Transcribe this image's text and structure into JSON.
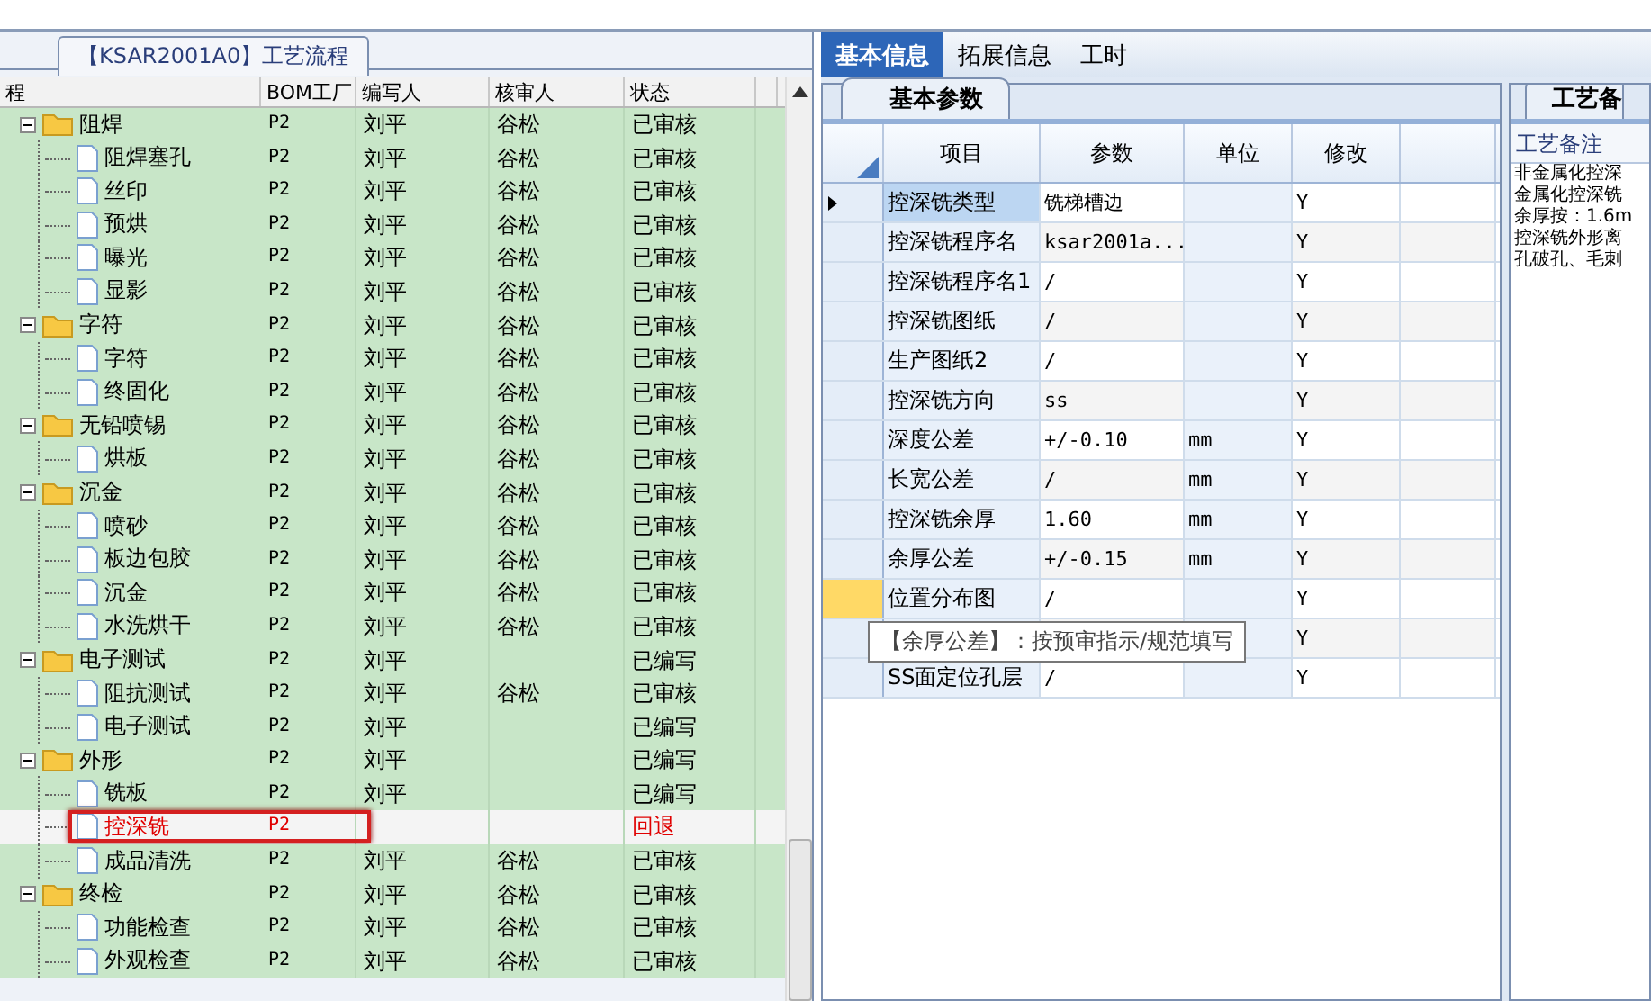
{
  "left_panel": {
    "tab": "【KSAR2001A0】工艺流程",
    "columns": [
      "程",
      "BOM工厂",
      "编写人",
      "核审人",
      "状态"
    ],
    "tree": [
      {
        "name": "阻焊",
        "bom": "P2",
        "writer": "刘平",
        "reviewer": "谷松",
        "status": "已审核",
        "expanded": true,
        "selected": false,
        "children": [
          {
            "name": "阻焊塞孔",
            "bom": "P2",
            "writer": "刘平",
            "reviewer": "谷松",
            "status": "已审核",
            "selected": false
          },
          {
            "name": "丝印",
            "bom": "P2",
            "writer": "刘平",
            "reviewer": "谷松",
            "status": "已审核",
            "selected": false
          },
          {
            "name": "预烘",
            "bom": "P2",
            "writer": "刘平",
            "reviewer": "谷松",
            "status": "已审核",
            "selected": false
          },
          {
            "name": "曝光",
            "bom": "P2",
            "writer": "刘平",
            "reviewer": "谷松",
            "status": "已审核",
            "selected": false
          },
          {
            "name": "显影",
            "bom": "P2",
            "writer": "刘平",
            "reviewer": "谷松",
            "status": "已审核",
            "selected": false
          }
        ]
      },
      {
        "name": "字符",
        "bom": "P2",
        "writer": "刘平",
        "reviewer": "谷松",
        "status": "已审核",
        "expanded": true,
        "selected": false,
        "children": [
          {
            "name": "字符",
            "bom": "P2",
            "writer": "刘平",
            "reviewer": "谷松",
            "status": "已审核",
            "selected": false
          },
          {
            "name": "终固化",
            "bom": "P2",
            "writer": "刘平",
            "reviewer": "谷松",
            "status": "已审核",
            "selected": false
          }
        ]
      },
      {
        "name": "无铅喷锡",
        "bom": "P2",
        "writer": "刘平",
        "reviewer": "谷松",
        "status": "已审核",
        "expanded": true,
        "selected": false,
        "children": [
          {
            "name": "烘板",
            "bom": "P2",
            "writer": "刘平",
            "reviewer": "谷松",
            "status": "已审核",
            "selected": false
          }
        ]
      },
      {
        "name": "沉金",
        "bom": "P2",
        "writer": "刘平",
        "reviewer": "谷松",
        "status": "已审核",
        "expanded": true,
        "selected": false,
        "children": [
          {
            "name": "喷砂",
            "bom": "P2",
            "writer": "刘平",
            "reviewer": "谷松",
            "status": "已审核",
            "selected": false
          },
          {
            "name": "板边包胶",
            "bom": "P2",
            "writer": "刘平",
            "reviewer": "谷松",
            "status": "已审核",
            "selected": false
          },
          {
            "name": "沉金",
            "bom": "P2",
            "writer": "刘平",
            "reviewer": "谷松",
            "status": "已审核",
            "selected": false
          },
          {
            "name": "水洗烘干",
            "bom": "P2",
            "writer": "刘平",
            "reviewer": "谷松",
            "status": "已审核",
            "selected": false
          }
        ]
      },
      {
        "name": "电子测试",
        "bom": "P2",
        "writer": "刘平",
        "status": "已编写",
        "expanded": true,
        "selected": false,
        "children": [
          {
            "name": "阻抗测试",
            "bom": "P2",
            "writer": "刘平",
            "reviewer": "谷松",
            "status": "已审核",
            "selected": false
          },
          {
            "name": "电子测试",
            "bom": "P2",
            "writer": "刘平",
            "status": "已编写",
            "selected": false
          }
        ]
      },
      {
        "name": "外形",
        "bom": "P2",
        "writer": "刘平",
        "status": "已编写",
        "expanded": true,
        "selected": false,
        "children": [
          {
            "name": "铣板",
            "bom": "P2",
            "writer": "刘平",
            "status": "已编写",
            "selected": false
          },
          {
            "name": "控深铣",
            "bom": "P2",
            "status": "回退",
            "selected": true
          },
          {
            "name": "成品清洗",
            "bom": "P2",
            "writer": "刘平",
            "reviewer": "谷松",
            "status": "已审核",
            "selected": false
          }
        ]
      },
      {
        "name": "终检",
        "bom": "P2",
        "writer": "刘平",
        "reviewer": "谷松",
        "status": "已审核",
        "expanded": true,
        "selected": false,
        "children": [
          {
            "name": "功能检查",
            "bom": "P2",
            "writer": "刘平",
            "reviewer": "谷松",
            "status": "已审核",
            "selected": false
          },
          {
            "name": "外观检查",
            "bom": "P2",
            "writer": "刘平",
            "reviewer": "谷松",
            "status": "已审核",
            "selected": false
          }
        ]
      }
    ]
  },
  "tabs": [
    {
      "label": "基本信息",
      "selected": true
    },
    {
      "label": "拓展信息",
      "selected": false
    },
    {
      "label": "工时",
      "selected": false
    }
  ],
  "params": {
    "tab": "基本参数",
    "columns": [
      "项目",
      "参数",
      "单位",
      "修改"
    ],
    "rows": [
      {
        "item": "控深铣类型",
        "value": "铣梯槽边",
        "modified": "Y",
        "selected": true,
        "flagged": false
      },
      {
        "item": "控深铣程序名",
        "value": "ksar2001a...",
        "modified": "Y",
        "selected": false,
        "flagged": false
      },
      {
        "item": "控深铣程序名1",
        "value": "/",
        "modified": "Y",
        "selected": false,
        "flagged": false
      },
      {
        "item": "控深铣图纸",
        "value": "/",
        "modified": "Y",
        "selected": false,
        "flagged": false
      },
      {
        "item": "生产图纸2",
        "value": "/",
        "modified": "Y",
        "selected": false,
        "flagged": false
      },
      {
        "item": "控深铣方向",
        "value": "ss",
        "modified": "Y",
        "selected": false,
        "flagged": false
      },
      {
        "item": "深度公差",
        "value": "+/-0.10",
        "unit": "mm",
        "modified": "Y",
        "selected": false,
        "flagged": false
      },
      {
        "item": "长宽公差",
        "value": "/",
        "unit": "mm",
        "modified": "Y",
        "selected": false,
        "flagged": false
      },
      {
        "item": "控深铣余厚",
        "value": "1.60",
        "unit": "mm",
        "modified": "Y",
        "selected": false,
        "flagged": false
      },
      {
        "item": "余厚公差",
        "value": "+/-0.15",
        "unit": "mm",
        "modified": "Y",
        "selected": false,
        "flagged": false
      },
      {
        "item": "位置分布图",
        "value": "/",
        "modified": "Y",
        "selected": false,
        "flagged": true
      },
      {
        "modified": "Y",
        "selected": false,
        "flagged": false
      },
      {
        "item": "SS面定位孔层",
        "value": "/",
        "modified": "Y",
        "selected": false,
        "flagged": false
      }
    ],
    "tooltip": "【余厚公差】：按预审指示/规范填写"
  },
  "notes": {
    "tab": "工艺备",
    "label": "工艺备注",
    "lines": [
      "非金属化控深",
      "金属化控深铣",
      "余厚按：1.6m",
      "控深铣外形离",
      "孔破孔、毛刺"
    ]
  }
}
